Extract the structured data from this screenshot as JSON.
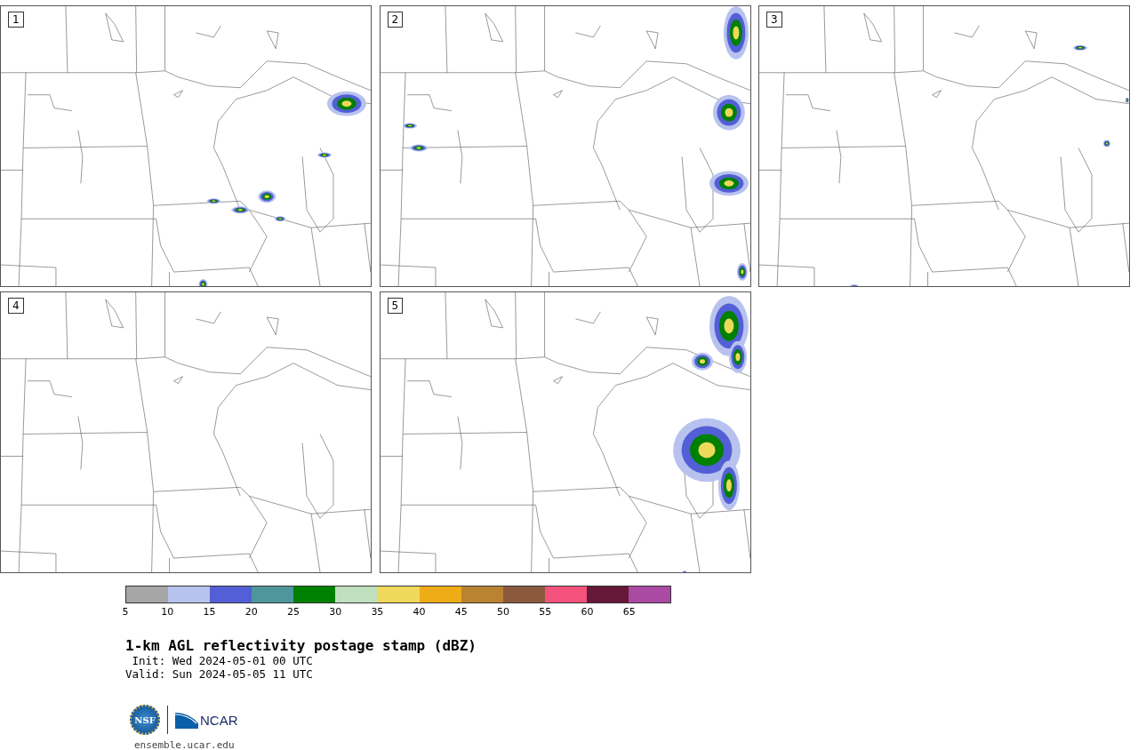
{
  "panels": [
    {
      "label": "1"
    },
    {
      "label": "2"
    },
    {
      "label": "3"
    },
    {
      "label": "4"
    },
    {
      "label": "5"
    }
  ],
  "colorbar": {
    "segments": [
      {
        "color": "#a6a6a6"
      },
      {
        "color": "#b8c2ee"
      },
      {
        "color": "#525fd6"
      },
      {
        "color": "#4f969c"
      },
      {
        "color": "#008000"
      },
      {
        "color": "#c0dfbf"
      },
      {
        "color": "#efd95b"
      },
      {
        "color": "#eeac17"
      },
      {
        "color": "#ba8331"
      },
      {
        "color": "#8b5a3e"
      },
      {
        "color": "#f5517d"
      },
      {
        "color": "#661838"
      },
      {
        "color": "#ab4aa3"
      }
    ],
    "ticks": [
      "5",
      "10",
      "15",
      "20",
      "25",
      "30",
      "35",
      "40",
      "45",
      "50",
      "55",
      "60",
      "65"
    ]
  },
  "title": "1-km AGL reflectivity postage stamp (dBZ)",
  "init": " Init: Wed 2024-05-01 00 UTC",
  "valid": "Valid: Sun 2024-05-05 11 UTC",
  "logos": {
    "nsf": "NSF",
    "ncar": "NCAR"
  },
  "url": "ensemble.ucar.edu"
}
